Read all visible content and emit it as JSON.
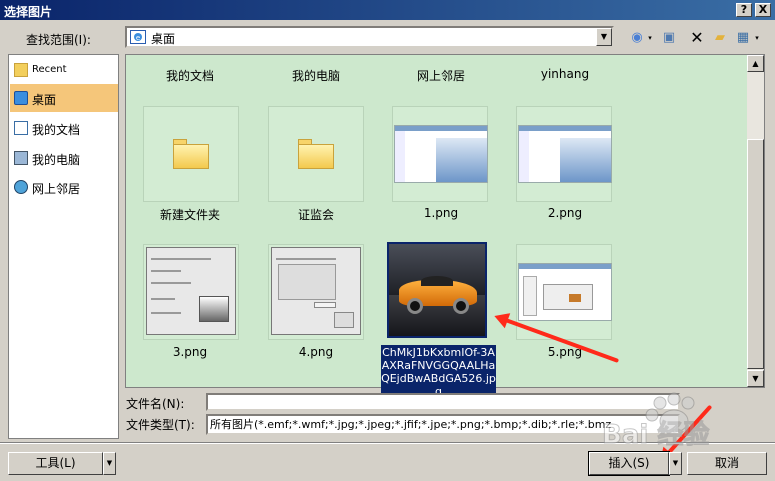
{
  "window": {
    "title": "选择图片",
    "help_label": "?",
    "close_label": "X"
  },
  "lookin": {
    "label": "查找范围(I):",
    "value": "桌面"
  },
  "places": [
    {
      "label": "Recent",
      "icon": "folder-icon"
    },
    {
      "label": "桌面",
      "icon": "desktop-icon",
      "selected": true
    },
    {
      "label": "我的文档",
      "icon": "documents-icon"
    },
    {
      "label": "我的电脑",
      "icon": "computer-icon"
    },
    {
      "label": "网上邻居",
      "icon": "network-icon"
    }
  ],
  "files": {
    "row0": [
      "我的文档",
      "我的电脑",
      "网上邻居",
      "yinhang"
    ],
    "row1": [
      "新建文件夹",
      "证监会",
      "1.png",
      "2.png"
    ],
    "row2": [
      "3.png",
      "4.png",
      "ChMkJ1bKxbmIOf-3AAXRaFNVGGQAALHaQEjdBwABdGA526.jpg",
      "5.png"
    ]
  },
  "filename": {
    "label": "文件名(N):",
    "value": ""
  },
  "filetype": {
    "label": "文件类型(T):",
    "value": "所有图片(*.emf;*.wmf;*.jpg;*.jpeg;*.jfif;*.jpe;*.png;*.bmp;*.dib;*.rle;*.bmz"
  },
  "buttons": {
    "tools": "工具(L)",
    "insert": "插入(S)",
    "cancel": "取消"
  },
  "watermark": {
    "text": "Bai 经验"
  }
}
